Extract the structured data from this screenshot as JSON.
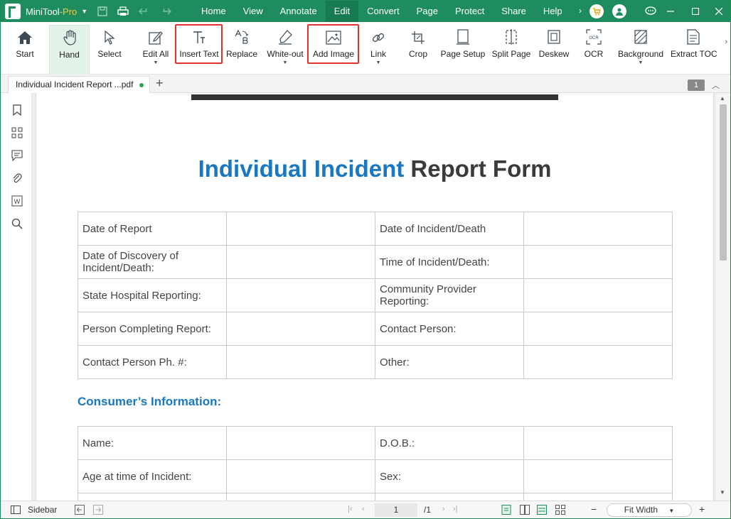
{
  "app": {
    "name_main": "MiniTool",
    "name_suffix": "-Pro"
  },
  "menu": [
    "Home",
    "View",
    "Annotate",
    "Edit",
    "Convert",
    "Page",
    "Protect",
    "Share",
    "Help"
  ],
  "menu_active": "Edit",
  "toolbar": {
    "start": "Start",
    "hand": "Hand",
    "select": "Select",
    "edit_all": "Edit All",
    "insert_text": "Insert Text",
    "replace": "Replace",
    "white_out": "White-out",
    "add_image": "Add Image",
    "link": "Link",
    "crop": "Crop",
    "page_setup": "Page Setup",
    "split_page": "Split Page",
    "deskew": "Deskew",
    "ocr": "OCR",
    "background": "Background",
    "extract_toc": "Extract TOC"
  },
  "tab": {
    "filename": "Individual Incident Report ...pdf",
    "page_badge": "1"
  },
  "document": {
    "title_blue": "Individual Incident",
    "title_dark": "Report Form",
    "table1": [
      [
        "Date of Report",
        "",
        "Date of Incident/Death",
        ""
      ],
      [
        "Date of Discovery of Incident/Death:",
        "",
        "Time of Incident/Death:",
        ""
      ],
      [
        "State Hospital Reporting:",
        "",
        "Community Provider Reporting:",
        ""
      ],
      [
        "Person Completing Report:",
        "",
        "Contact Person:",
        ""
      ],
      [
        "Contact Person Ph. #:",
        "",
        "Other:",
        ""
      ]
    ],
    "section_title": "Consumer’s Information:",
    "table2": [
      [
        "Name:",
        "",
        "D.O.B.:",
        ""
      ],
      [
        "Age at time of Incident:",
        "",
        "Sex:",
        ""
      ],
      [
        "",
        "",
        "",
        ""
      ]
    ]
  },
  "statusbar": {
    "sidebar": "Sidebar",
    "current_page": "1",
    "total_pages": "/1",
    "zoom": "Fit Width"
  },
  "colors": {
    "brand": "#1f8c5e",
    "highlight": "#e0332b",
    "title_blue": "#1a78c2"
  }
}
